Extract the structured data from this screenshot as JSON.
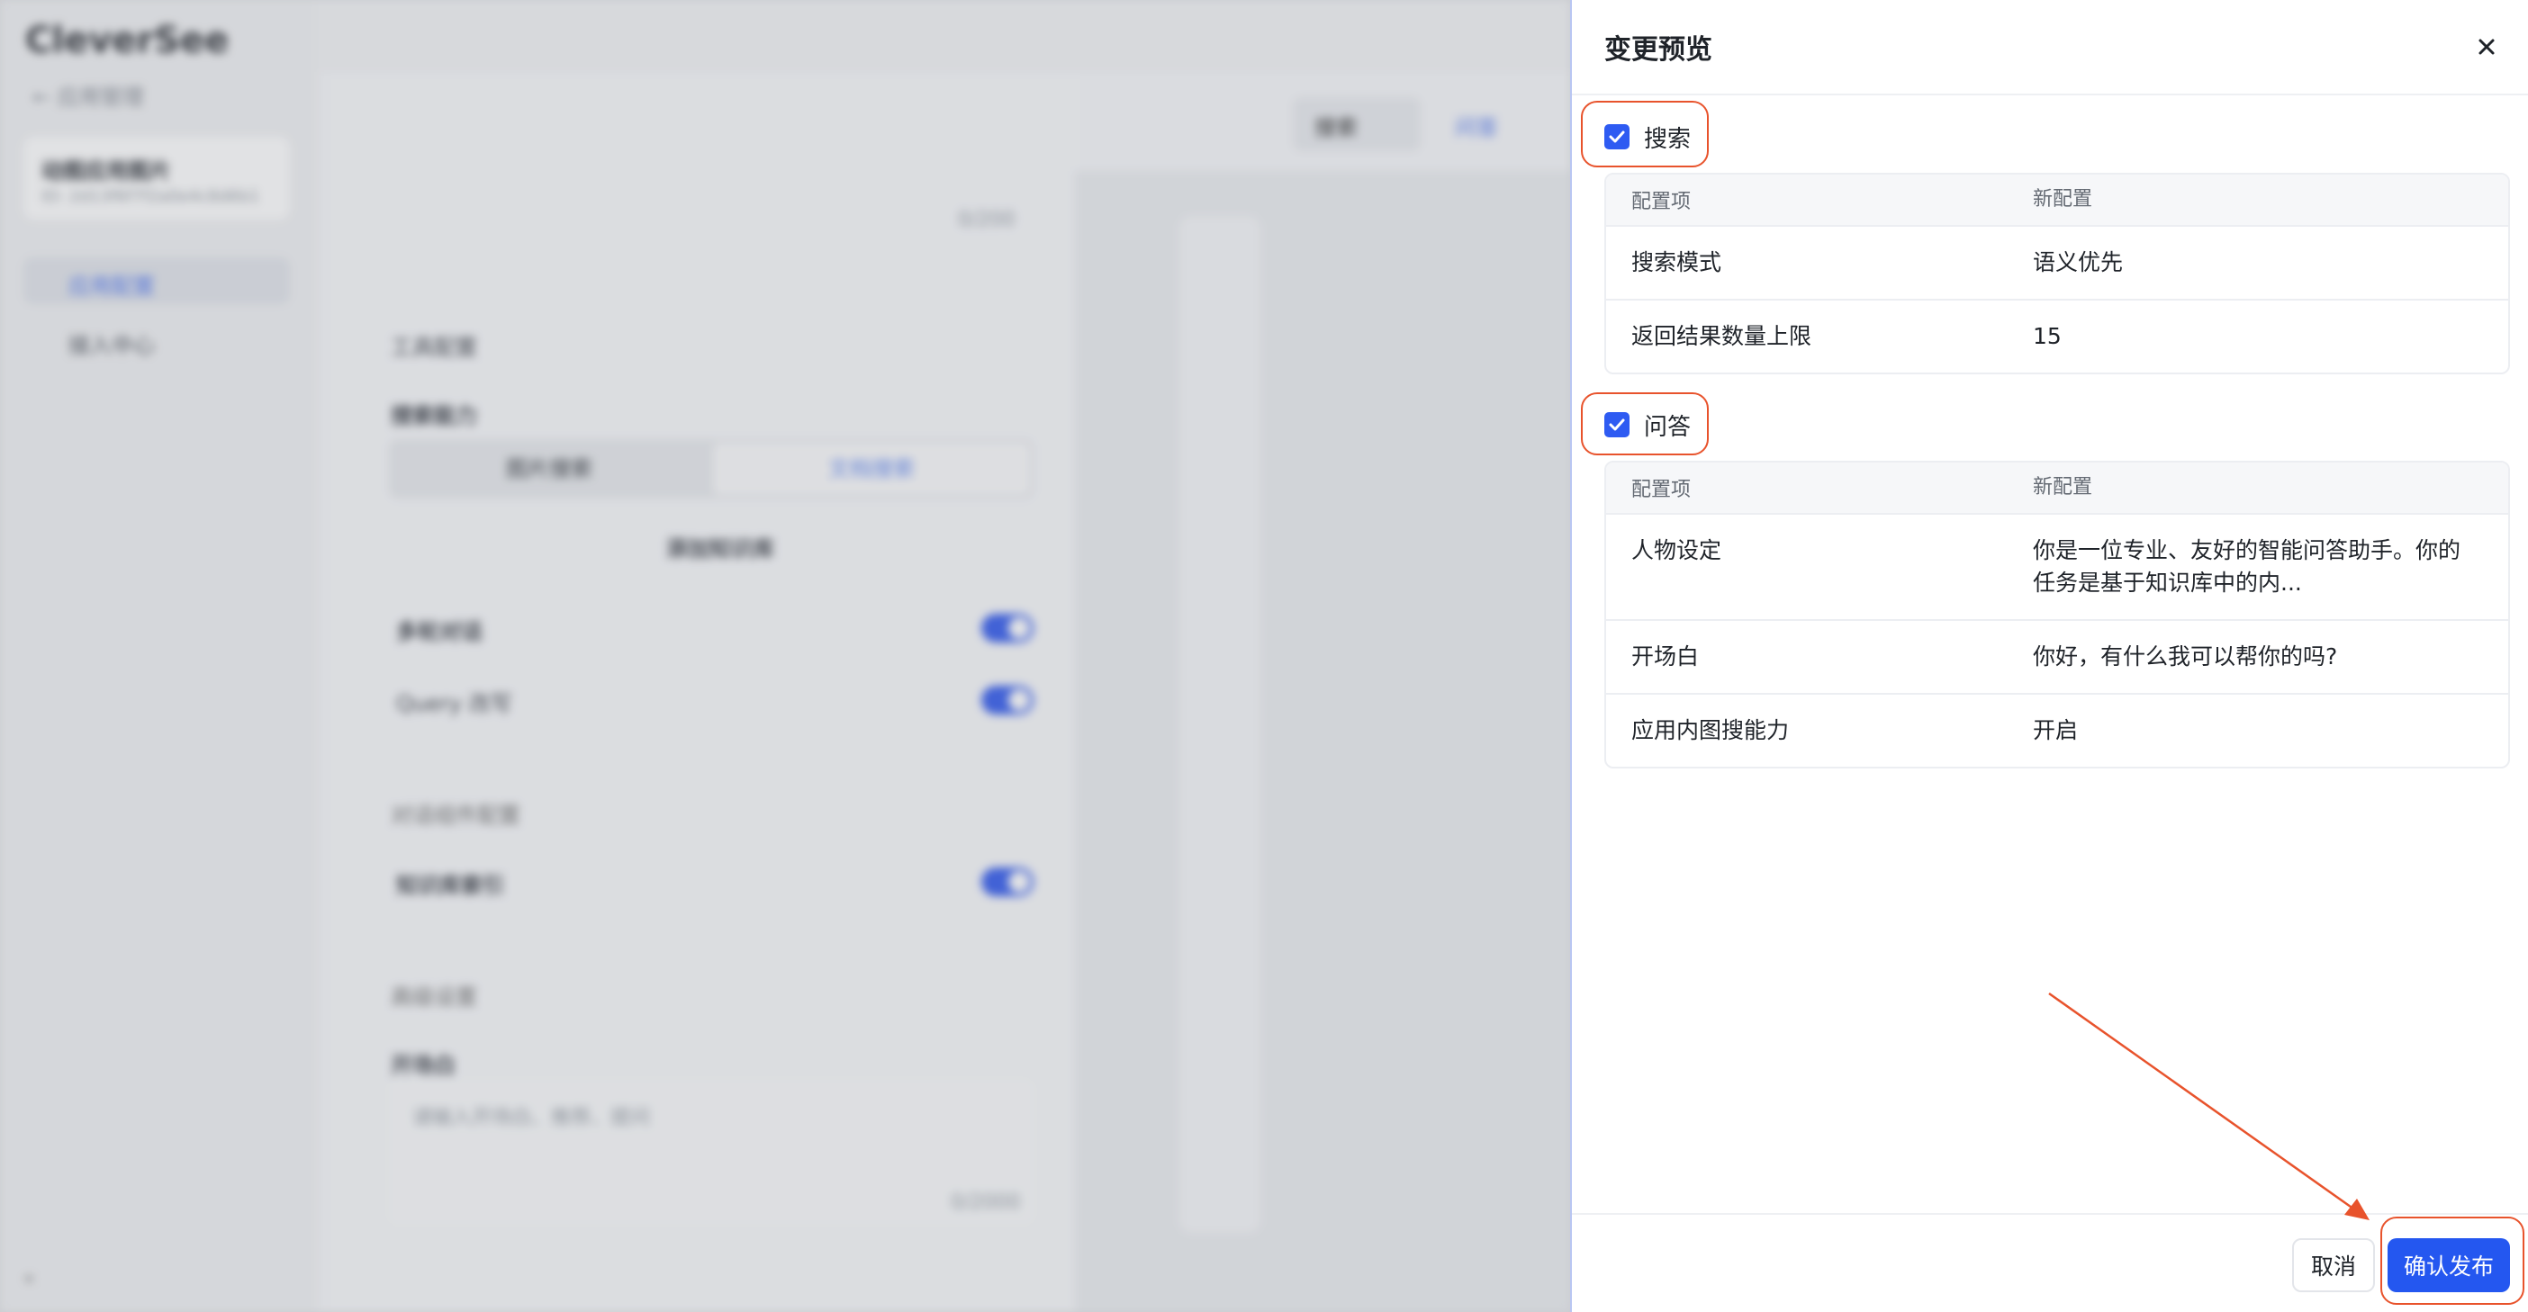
{
  "background_app": {
    "brand": "CleverSee",
    "back_label": "应用管理",
    "app_name": "动图应用图片",
    "app_id": "ID: 2d13f6f7f2a0e4c8d6b1",
    "nav": [
      "应用配置",
      "接入中心"
    ],
    "toolbar": {
      "search_label": "搜索",
      "qa_label": "问答"
    },
    "char_count_top": "0/200",
    "tool_config_label": "工具配置",
    "search_ability_label": "搜索能力",
    "segment": [
      "图片搜索",
      "文档搜索"
    ],
    "add_kb_label": "添加知识库",
    "toggle_items": [
      "多轮对话",
      "Query 改写"
    ],
    "component_config_label": "对话组件配置",
    "kb_reference_label": "知识库索引",
    "advanced_label": "高级设置",
    "prologue_label": "开场白",
    "prologue_placeholder": "请输入开场白、推荐、提问",
    "char_count_bottom": "0/2000"
  },
  "drawer": {
    "title": "变更预览",
    "close_icon": "close-icon",
    "sections": [
      {
        "label": "搜索",
        "checked": true,
        "columns": [
          "配置项",
          "新配置"
        ],
        "rows": [
          {
            "item": "搜索模式",
            "value": "语义优先"
          },
          {
            "item": "返回结果数量上限",
            "value": "15"
          }
        ]
      },
      {
        "label": "问答",
        "checked": true,
        "columns": [
          "配置项",
          "新配置"
        ],
        "rows": [
          {
            "item": "人物设定",
            "value": "你是一位专业、友好的智能问答助手。你的任务是基于知识库中的内..."
          },
          {
            "item": "开场白",
            "value": "你好，有什么我可以帮你的吗?"
          },
          {
            "item": "应用内图搜能力",
            "value": "开启"
          }
        ]
      }
    ],
    "cancel_label": "取消",
    "confirm_label": "确认发布"
  },
  "colors": {
    "accent": "#2457f0",
    "checkbox": "#2e5bf2",
    "annotation": "#e8532c"
  }
}
